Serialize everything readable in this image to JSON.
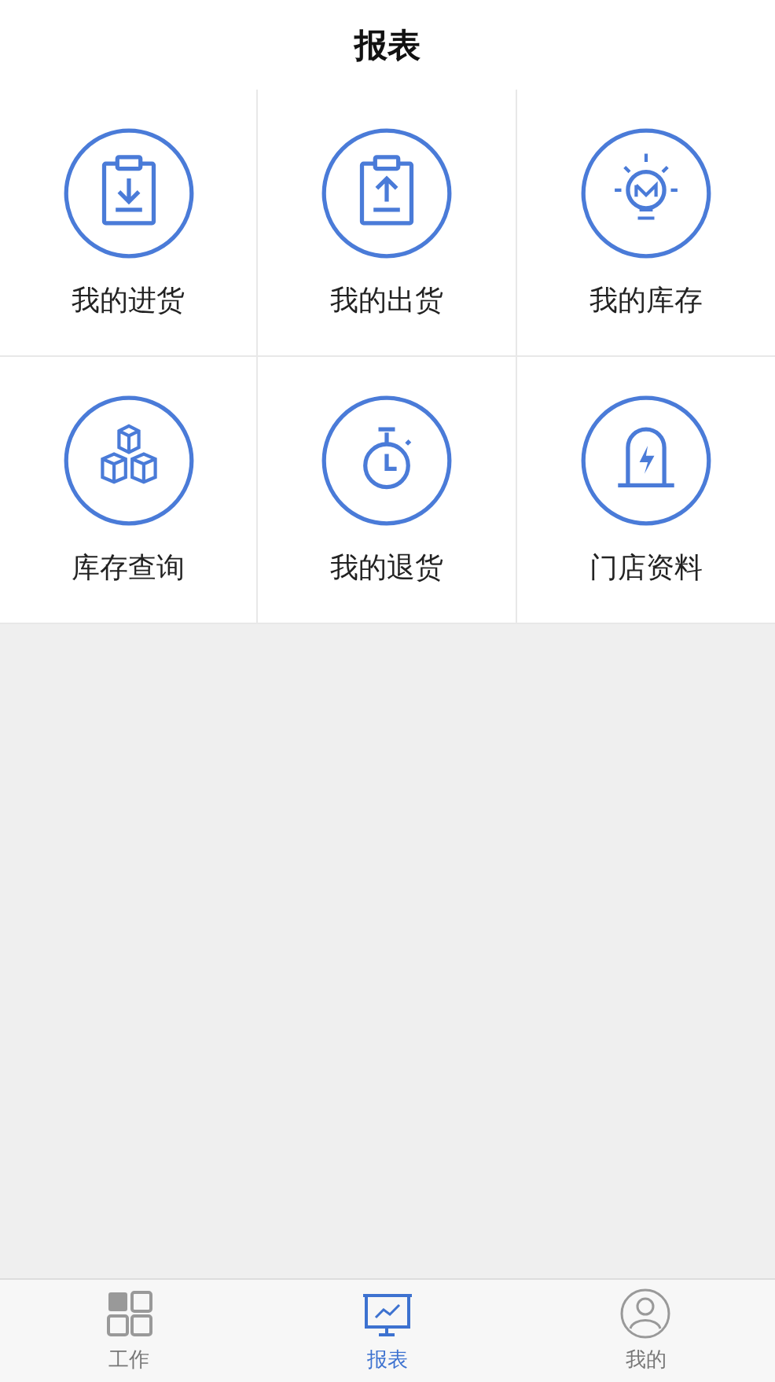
{
  "header": {
    "title": "报表"
  },
  "tiles": [
    {
      "label": "我的进货",
      "kind": "download"
    },
    {
      "label": "我的出货",
      "kind": "upload"
    },
    {
      "label": "我的库存",
      "kind": "bulb"
    },
    {
      "label": "库存查询",
      "kind": "boxes"
    },
    {
      "label": "我的退货",
      "kind": "stopwatch"
    },
    {
      "label": "门店资料",
      "kind": "gate"
    }
  ],
  "tab_bar": [
    {
      "label": "工作",
      "kind": "grid",
      "selected": false
    },
    {
      "label": "报表",
      "kind": "chart",
      "selected": true
    },
    {
      "label": "我的",
      "kind": "user",
      "selected": false
    }
  ]
}
